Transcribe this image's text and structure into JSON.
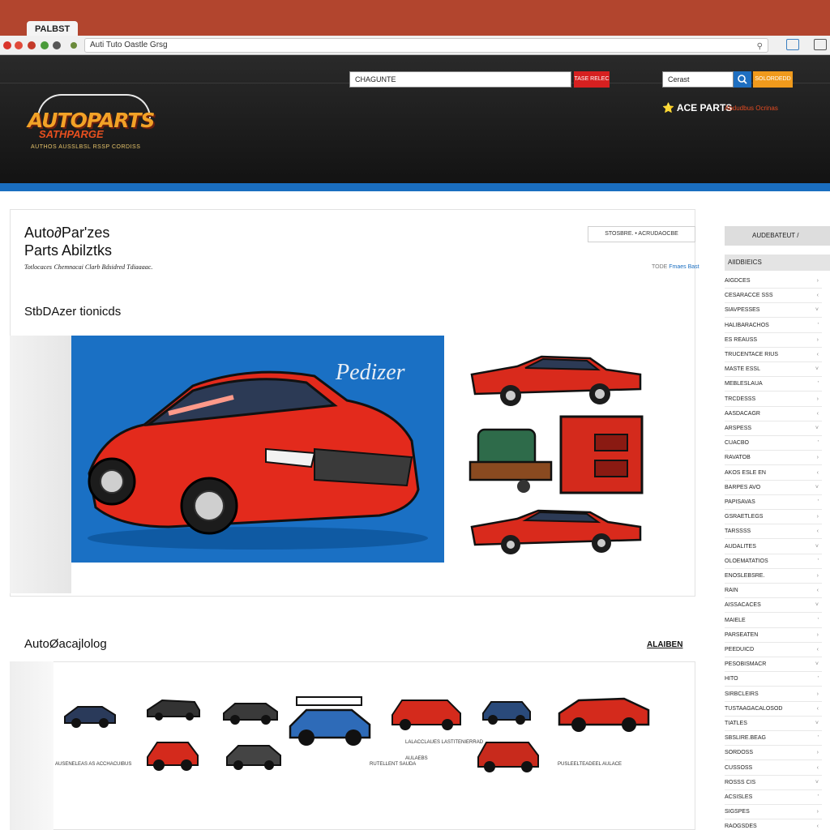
{
  "browser": {
    "tab_label": "PALBST",
    "address_text": "Auti Tuto Oastle Grsg"
  },
  "header": {
    "logo_text": "AUTOPARTS",
    "logo_sub": "SATHPARGE",
    "logo_tagline": "AUTHOS AUSSLBSL RSSP CORDISS",
    "search1_value": "CHAGUNTE",
    "search1_button": "TASE RELEC",
    "search2_value": "Cerast",
    "search2_button": "SOLORDEDD",
    "brand_label": "ACE PARTS",
    "brand_sub": "Abdudbus Ocrinas"
  },
  "hero": {
    "title_line1": "Auto∂Par'zes",
    "title_line2": "Parts Abilztks",
    "tagline_main": "Totlocaces",
    "tagline_rest": "Chemnacai Clarb Bdsidred Tdiaaaac.",
    "filter_label": "STOSBRE. • ACRUDAOCBE",
    "small_link_gray": "TODE",
    "small_link_blue": "Fmaes Bast",
    "section_title": "StbDAzer tionicds",
    "feature_logo": "Pedizer"
  },
  "catalog": {
    "title": "AutoØacajlolog",
    "link_label": "ALAIBEN",
    "labels": [
      "AUSENELEAS AS ACCHACUIBUS",
      "RUTELLENT SAUDA",
      "LALACCLAUES LASTITENIERRAD",
      "AULAEBS",
      "PUSLEELTEADEEL AULACE"
    ]
  },
  "sidebar": {
    "header_label": "AUDEBATEUT",
    "section_label": "AIIDBIEICS",
    "items": [
      "AIGDCES",
      "CESARACCE SSS",
      "SIAVPESSES",
      "HALIBARACHOS",
      "ES REAUSS",
      "TRUCENTACE RIUS",
      "MASTE ESSL",
      "MEBLESLAUA",
      "TRCDESSS",
      "AASDACAGR",
      "ARSPESS",
      "CUACBO",
      "RAVATOB",
      "AKOS ESLE EN",
      "BARPES AVO",
      "PAPISAVAS",
      "GSRAETLEGS",
      "TARSSSS",
      "AUDALITES",
      "OLOEMATATIOS",
      "ENOSLEBSRE.",
      "RAIN",
      "AISSACACES",
      "MAIELE",
      "PARSEATEN",
      "PEEDUICD",
      "PESOBISMACR",
      "HITO",
      "SIRBCLEIRS",
      "TUSTAAGACALOSOD",
      "TIATLES",
      "SBSLIRE.BEAG",
      "SORDOSS",
      "CUSSOSS",
      "ROSSS CIS",
      "ACSISLES",
      "SIGSPES",
      "RAOGSDES"
    ]
  }
}
